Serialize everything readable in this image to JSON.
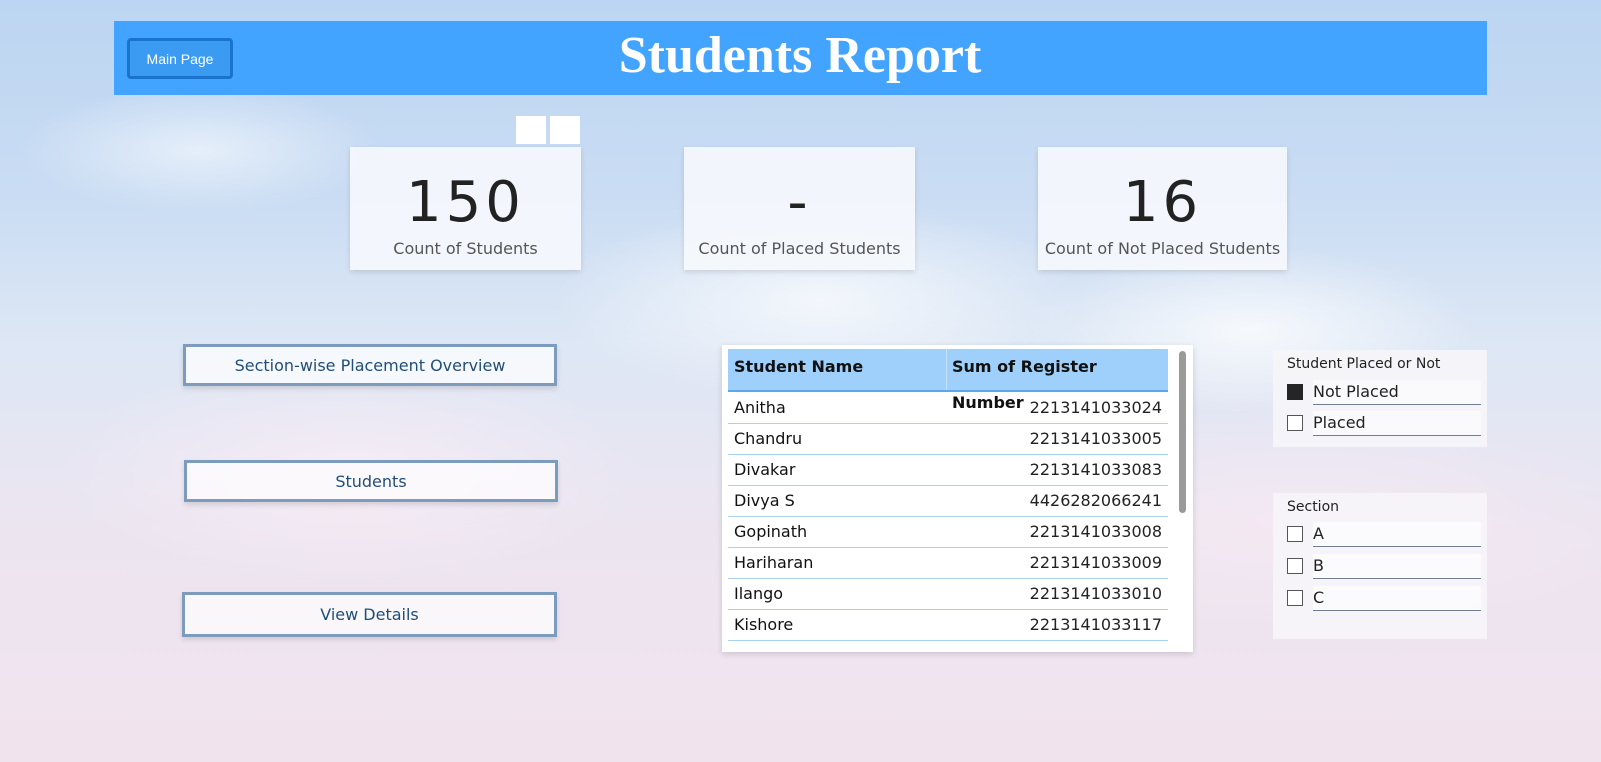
{
  "header": {
    "title": "Students Report",
    "main_page_label": "Main Page",
    "bg_color": "#43a4ff"
  },
  "kpis": [
    {
      "value": "150",
      "label": "Count of Students"
    },
    {
      "value": "-",
      "label": "Count of Placed Students"
    },
    {
      "value": "16",
      "label": "Count of Not Placed Students"
    }
  ],
  "nav": {
    "section_overview": "Section-wise Placement Overview",
    "students": "Students",
    "view_details": "View Details"
  },
  "table": {
    "columns": [
      "Student Name",
      "Sum of Register Number"
    ],
    "rows": [
      {
        "name": "Anitha",
        "reg": "2213141033024"
      },
      {
        "name": "Chandru",
        "reg": "2213141033005"
      },
      {
        "name": "Divakar",
        "reg": "2213141033083"
      },
      {
        "name": "Divya S",
        "reg": "4426282066241"
      },
      {
        "name": "Gopinath",
        "reg": "2213141033008"
      },
      {
        "name": "Hariharan",
        "reg": "2213141033009"
      },
      {
        "name": "Ilango",
        "reg": "2213141033010"
      },
      {
        "name": "Kishore",
        "reg": "2213141033117"
      }
    ]
  },
  "slicers": {
    "placed": {
      "title": "Student Placed or Not",
      "options": [
        {
          "label": "Not Placed",
          "checked": true
        },
        {
          "label": "Placed",
          "checked": false
        }
      ]
    },
    "section": {
      "title": "Section",
      "options": [
        {
          "label": "A",
          "checked": false
        },
        {
          "label": "B",
          "checked": false
        },
        {
          "label": "C",
          "checked": false
        }
      ]
    }
  }
}
